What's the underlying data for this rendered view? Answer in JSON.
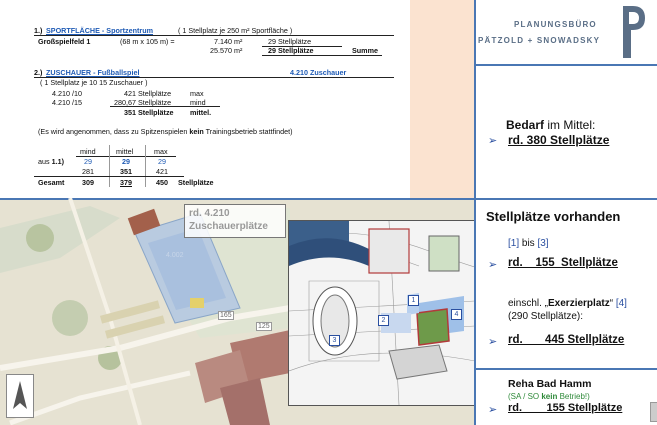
{
  "logo": {
    "line1": "PLANUNGSBÜRO",
    "line2": "PÄTZOLD + SNOWADSKY"
  },
  "calc": {
    "s1_num": "1.)",
    "s1_title": "SPORTFLÄCHE  - Sportzentrum",
    "s1_note": "( 1 Stellplatz je 250 m² Sportfläche )",
    "r1_label": "Großspielfeld 1",
    "r1_dims": "(68 m  x   105 m)  =",
    "r1_area": "7.140 m²",
    "r1_result": "29 Stellplätze",
    "r2_area": "25.570 m²",
    "r2_result": "29 Stellplätze",
    "r2_sum": "Summe",
    "s2_num": "2.)",
    "s2_title": "ZUSCHAUER  - Fußballspiel",
    "s2_total": "4.210 Zuschauer",
    "s2_note": "( 1 Stellplatz je 10   15 Zuschauer )",
    "z1_a": "4.210 /10",
    "z1_b": "421 Stellplätze",
    "z1_c": "max",
    "z2_a": "4.210 /15",
    "z2_b": "280,67 Stellplätze",
    "z2_c": "mind",
    "z3_b": "351 Stellplätze",
    "z3_c": "mittel.",
    "assump_a": "(Es wird angenommen, dass zu Spitzenspielen ",
    "assump_kein": "kein",
    "assump_b": " Trainingsbetrieb stattfindet)",
    "t_h1": "mind",
    "t_h2": "mittel",
    "t_h3": "max",
    "t_r1_label": "aus 1.1)",
    "t_r1": [
      "29",
      "29",
      "29"
    ],
    "t_r2": [
      "281",
      "351",
      "421"
    ],
    "t_r3_label": "Gesamt",
    "t_r3": [
      "309",
      "379",
      "450"
    ],
    "t_r3_unit": "Stellplätze"
  },
  "right": {
    "bedarf_a": "Bedarf",
    "bedarf_b": " im Mittel:",
    "bedarf_val": "rd. 380 Stellplätze",
    "vorhanden": "Stellplätze vorhanden",
    "ref_1": "[1]",
    "ref_bis": " bis ",
    "ref_3": "[3]",
    "v1": "rd.    155  Stellplätze",
    "einschl_a": "einschl. „",
    "einschl_b": "Exerzierplatz",
    "einschl_c": "“ ",
    "einschl_ref": "[4]",
    "einschl_note": "(290 Stellplätze):",
    "v2": "rd.       445 Stellplätze",
    "reha": "Reha Bad Hamm",
    "reha_note_a": "(SA / SO ",
    "reha_note_kein": "kein",
    "reha_note_b": " Betrieb!)",
    "v3": "rd.        155 Stellplätze",
    "arrow": "➢"
  },
  "map": {
    "label1": "rd. 4.210",
    "label2": "Zuschauerplätze",
    "road1": "165",
    "road2": "125",
    "field_num": "4.002",
    "inset_markers": [
      "1",
      "2",
      "3",
      "4"
    ]
  }
}
